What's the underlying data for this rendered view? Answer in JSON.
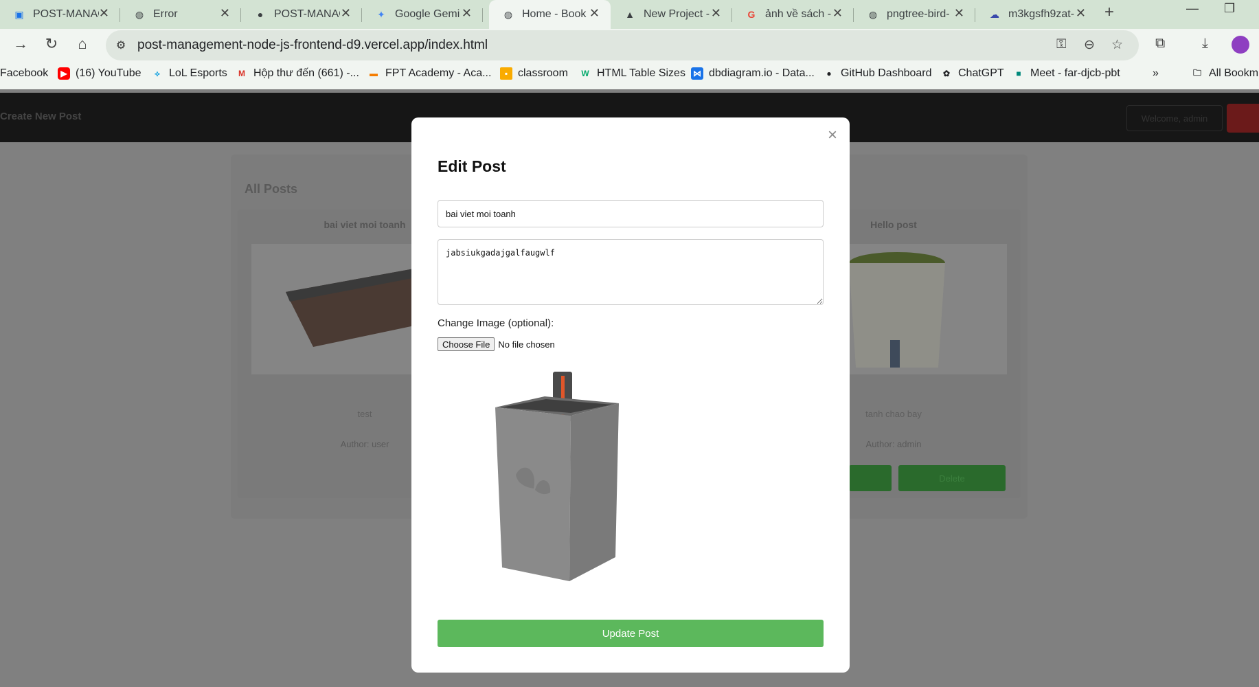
{
  "browser": {
    "tabs": [
      {
        "title": "POST-MANAG",
        "icon": "app-icon"
      },
      {
        "title": "Error",
        "icon": "globe-icon"
      },
      {
        "title": "POST-MANAG",
        "icon": "github-icon"
      },
      {
        "title": "Google Gemi",
        "icon": "gemini-icon"
      },
      {
        "title": "Home - Book",
        "icon": "globe-icon",
        "active": true
      },
      {
        "title": "New Project -",
        "icon": "triangle-icon"
      },
      {
        "title": "ảnh về sách -",
        "icon": "google-icon"
      },
      {
        "title": "pngtree-bird-",
        "icon": "globe-icon"
      },
      {
        "title": "m3kgsfh9zat-",
        "icon": "cloud-icon"
      }
    ],
    "url": "post-management-node-js-frontend-d9.vercel.app/index.html",
    "bookmarks": [
      {
        "label": "Facebook"
      },
      {
        "label": "(16) YouTube"
      },
      {
        "label": "LoL Esports"
      },
      {
        "label": "Hộp thư đến (661) -..."
      },
      {
        "label": "FPT Academy - Aca..."
      },
      {
        "label": "classroom"
      },
      {
        "label": "HTML Table Sizes"
      },
      {
        "label": "dbdiagram.io - Data..."
      },
      {
        "label": "GitHub Dashboard"
      },
      {
        "label": "ChatGPT"
      },
      {
        "label": "Meet - far-djcb-pbt"
      }
    ],
    "all_bookmarks": "All Bookm",
    "more_bookmarks": "»"
  },
  "background_page": {
    "brand": "Create New Post",
    "welcome": "Welcome, admin",
    "posts_heading": "All Posts",
    "cards": [
      {
        "title": "bai viet moi toanh",
        "content": "test",
        "author": "Author: user"
      },
      {
        "title": "Hello post",
        "content": "tanh chao bay",
        "author": "Author: admin",
        "delete_label": "Delete"
      }
    ]
  },
  "modal": {
    "heading": "Edit Post",
    "close_symbol": "×",
    "title_value": "bai viet moi toanh",
    "content_value": "jabsiukgadajgalfaugwlf",
    "image_label": "Change Image (optional):",
    "file_button": "Choose File",
    "file_status": "No file chosen",
    "submit_label": "Update Post"
  }
}
